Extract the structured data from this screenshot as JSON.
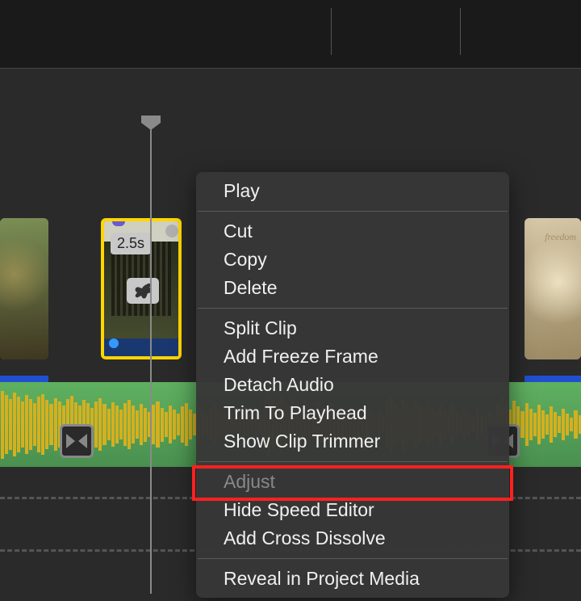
{
  "clip": {
    "duration_label": "2.5s",
    "right_label": "freedom"
  },
  "menu": {
    "items": [
      {
        "label": "Play",
        "enabled": true
      },
      {
        "sep": true
      },
      {
        "label": "Cut",
        "enabled": true
      },
      {
        "label": "Copy",
        "enabled": true
      },
      {
        "label": "Delete",
        "enabled": true
      },
      {
        "sep": true
      },
      {
        "label": "Split Clip",
        "enabled": true
      },
      {
        "label": "Add Freeze Frame",
        "enabled": true
      },
      {
        "label": "Detach Audio",
        "enabled": true
      },
      {
        "label": "Trim To Playhead",
        "enabled": true
      },
      {
        "label": "Show Clip Trimmer",
        "enabled": true,
        "highlighted": true
      },
      {
        "sep": true
      },
      {
        "label": "Adjust",
        "enabled": false
      },
      {
        "label": "Hide Speed Editor",
        "enabled": true
      },
      {
        "label": "Add Cross Dissolve",
        "enabled": true
      },
      {
        "sep": true
      },
      {
        "label": "Reveal in Project Media",
        "enabled": true
      }
    ]
  }
}
